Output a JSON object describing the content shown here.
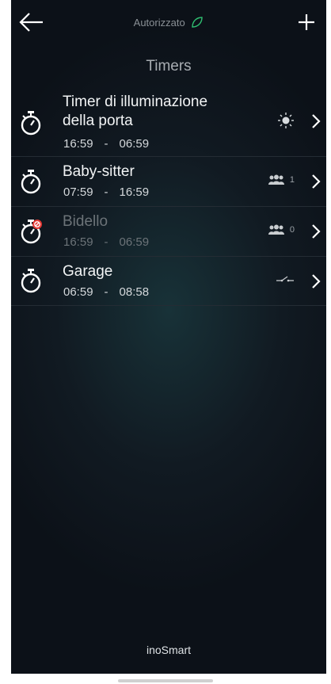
{
  "header": {
    "status_label": "Autorizzato",
    "back_icon": "arrow-left-icon",
    "add_icon": "plus-icon",
    "status_icon": "leaf-icon"
  },
  "page": {
    "title": "Timers"
  },
  "timers": [
    {
      "name_line1": "Timer di illuminazione",
      "name_line2": "della porta",
      "start": "16:59",
      "separator": "-",
      "end": "06:59",
      "type_icon": "sun-icon",
      "count": "",
      "enabled": true
    },
    {
      "name_line1": "Baby-sitter",
      "start": "07:59",
      "separator": "-",
      "end": "16:59",
      "type_icon": "users-icon",
      "count": "1",
      "enabled": true
    },
    {
      "name_line1": "Bidello",
      "start": "16:59",
      "separator": "-",
      "end": "06:59",
      "type_icon": "users-icon",
      "count": "0",
      "enabled": false
    },
    {
      "name_line1": "Garage",
      "start": "06:59",
      "separator": "-",
      "end": "08:58",
      "type_icon": "switch-icon",
      "count": "",
      "enabled": true
    }
  ],
  "footer": {
    "brand": "inoSmart"
  },
  "colors": {
    "background": "#111a22",
    "accent_green": "#2fbf71",
    "disabled_red": "#e53935"
  }
}
